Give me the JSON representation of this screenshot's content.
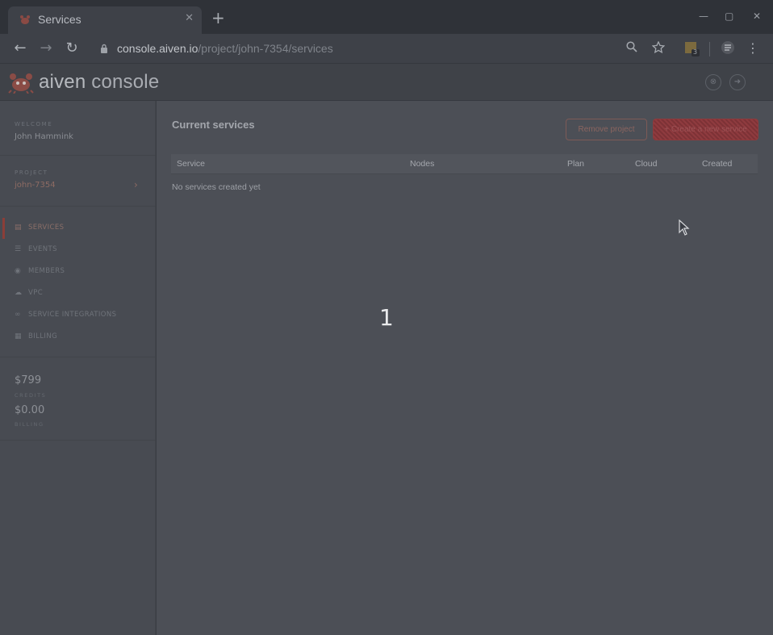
{
  "browser": {
    "tab_title": "Services",
    "tab_close": "✕",
    "new_tab": "+",
    "url_host": "console.aiven.io",
    "url_path": "/project/john-7354/services",
    "extension_badge": "3"
  },
  "app": {
    "logo_brand": "aiven",
    "logo_suffix": "console"
  },
  "sidebar": {
    "welcome_label": "WELCOME",
    "user_name": "John Hammink",
    "project_label": "PROJECT",
    "project_name": "john-7354",
    "nav": [
      {
        "label": "SERVICES",
        "icon": "server-icon",
        "active": true
      },
      {
        "label": "EVENTS",
        "icon": "list-icon",
        "active": false
      },
      {
        "label": "MEMBERS",
        "icon": "eye-icon",
        "active": false
      },
      {
        "label": "VPC",
        "icon": "cloud-icon",
        "active": false
      },
      {
        "label": "SERVICE INTEGRATIONS",
        "icon": "link-icon",
        "active": false
      },
      {
        "label": "BILLING",
        "icon": "bank-icon",
        "active": false
      }
    ],
    "credits_value": "$799",
    "credits_label": "CREDITS",
    "billing_value": "$0.00",
    "billing_label": "BILLING"
  },
  "main": {
    "title": "Current services",
    "remove_button": "Remove project",
    "create_button": "+ Create a new service",
    "columns": [
      "Service",
      "Nodes",
      "Plan",
      "Cloud",
      "Created"
    ],
    "empty_message": "No services created yet"
  },
  "overlay": {
    "number": "1"
  },
  "colors": {
    "accent": "#8b3e38",
    "create_button": "#8f3b3f"
  }
}
